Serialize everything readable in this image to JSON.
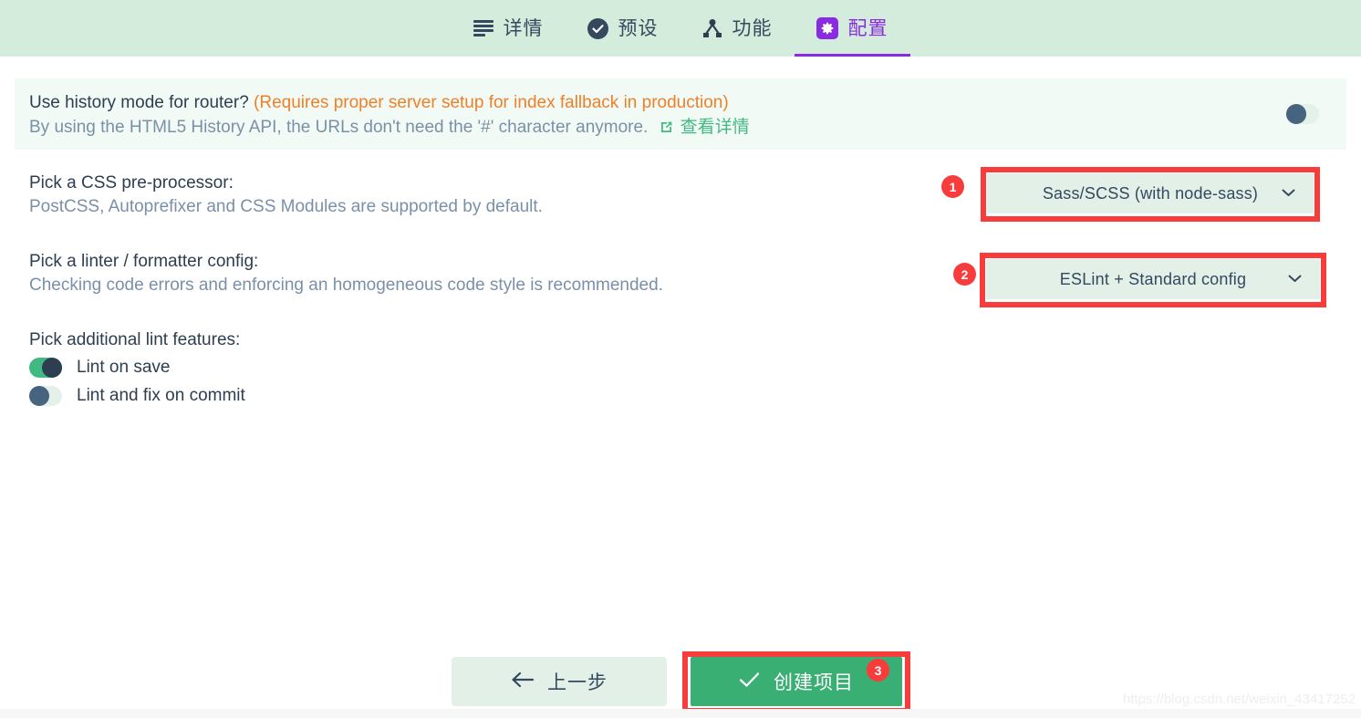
{
  "header": {
    "tabs": [
      {
        "label": "详情",
        "icon": "list-details-icon",
        "active": false
      },
      {
        "label": "预设",
        "icon": "check-circle-icon",
        "active": false
      },
      {
        "label": "功能",
        "icon": "node-hierarchy-icon",
        "active": false
      },
      {
        "label": "配置",
        "icon": "gear-icon",
        "active": true
      }
    ]
  },
  "history_section": {
    "question": "Use history mode for router?",
    "warning": "(Requires proper server setup for index fallback in production)",
    "description": "By using the HTML5 History API, the URLs don't need the '#' character anymore.",
    "link_label": "查看详情",
    "link_icon": "external-link-icon",
    "toggle_state": "off"
  },
  "options": [
    {
      "title": "Pick a CSS pre-processor:",
      "subtitle": "PostCSS, Autoprefixer and CSS Modules are supported by default.",
      "selected": "Sass/SCSS (with node-sass)",
      "badge": "1"
    },
    {
      "title": "Pick a linter / formatter config:",
      "subtitle": "Checking code errors and enforcing an homogeneous code style is recommended.",
      "selected": "ESLint + Standard config",
      "badge": "2"
    }
  ],
  "lint_features": {
    "title": "Pick additional lint features:",
    "items": [
      {
        "label": "Lint on save",
        "state": "on"
      },
      {
        "label": "Lint and fix on commit",
        "state": "off"
      }
    ]
  },
  "footer": {
    "back_label": "上一步",
    "back_icon": "arrow-left-icon",
    "create_label": "创建项目",
    "create_icon": "check-icon",
    "create_badge": "3"
  },
  "watermark": "https://blog.csdn.net/weixin_43417252",
  "colors": {
    "header_bg": "#d3ecdc",
    "accent_purple": "#8a2be2",
    "warning_orange": "#ef7f28",
    "green": "#42b983",
    "annotation_red": "#f83c3c",
    "muted_text": "#7a90a8",
    "dark_text": "#2c3e50"
  }
}
